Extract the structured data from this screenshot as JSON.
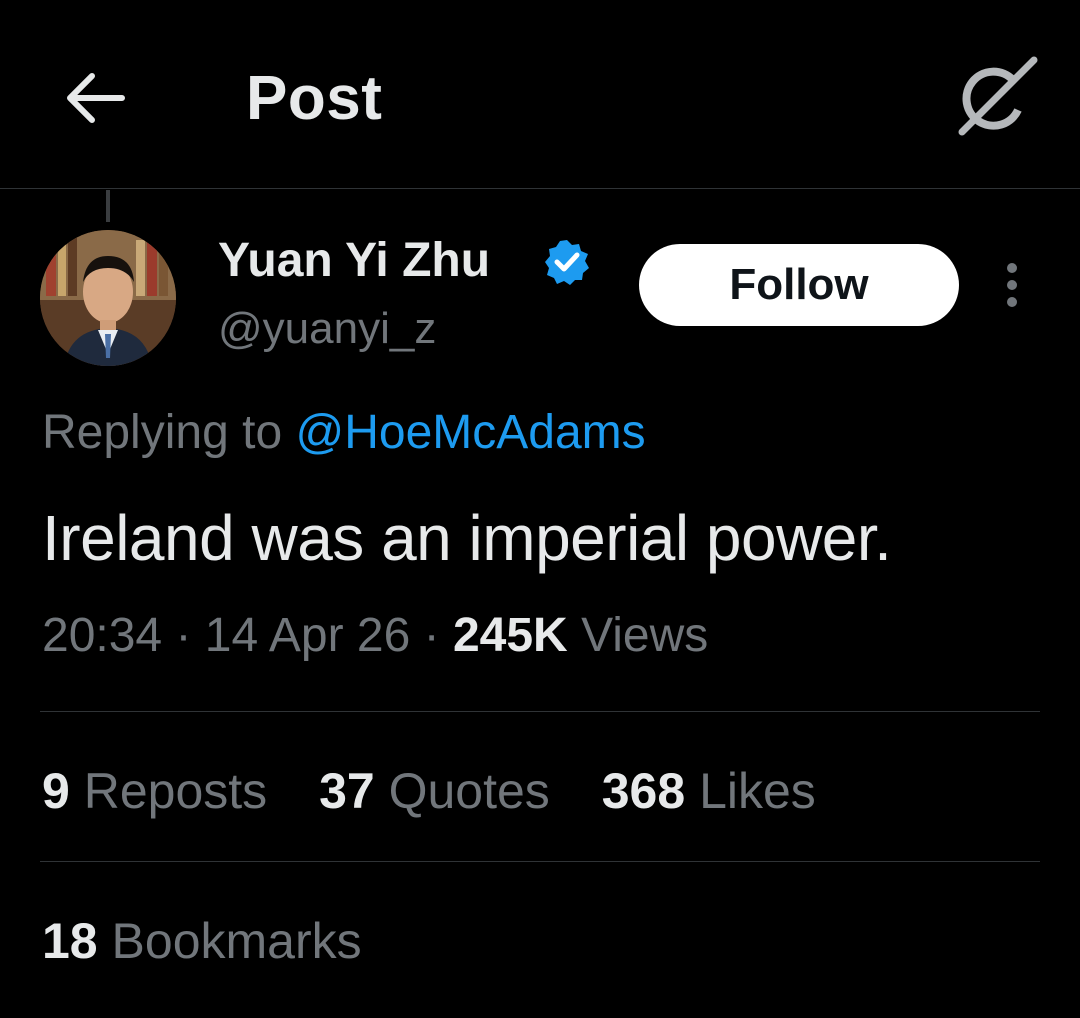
{
  "header": {
    "title": "Post",
    "back_icon": "arrow-left-icon",
    "grok_icon": "grok-icon"
  },
  "author": {
    "name": "Yuan Yi Zhu",
    "handle": "@yuanyi_z",
    "verified": true,
    "verified_color": "#1d9bf0",
    "follow_label": "Follow",
    "more_icon": "more-vertical-icon"
  },
  "reply": {
    "prefix": "Replying to",
    "target": "@HoeMcAdams"
  },
  "tweet": {
    "text": "Ireland was an imperial power."
  },
  "meta": {
    "time": "20:34",
    "date": "14 Apr 26",
    "views_count": "245K",
    "views_label": "Views"
  },
  "stats": {
    "reposts": {
      "count": "9",
      "label": "Reposts"
    },
    "quotes": {
      "count": "37",
      "label": "Quotes"
    },
    "likes": {
      "count": "368",
      "label": "Likes"
    },
    "bookmarks": {
      "count": "18",
      "label": "Bookmarks"
    }
  },
  "colors": {
    "background": "#000000",
    "primary_text": "#e7e9ea",
    "secondary_text": "#71767b",
    "link": "#1d9bf0",
    "divider": "#2f3336"
  }
}
